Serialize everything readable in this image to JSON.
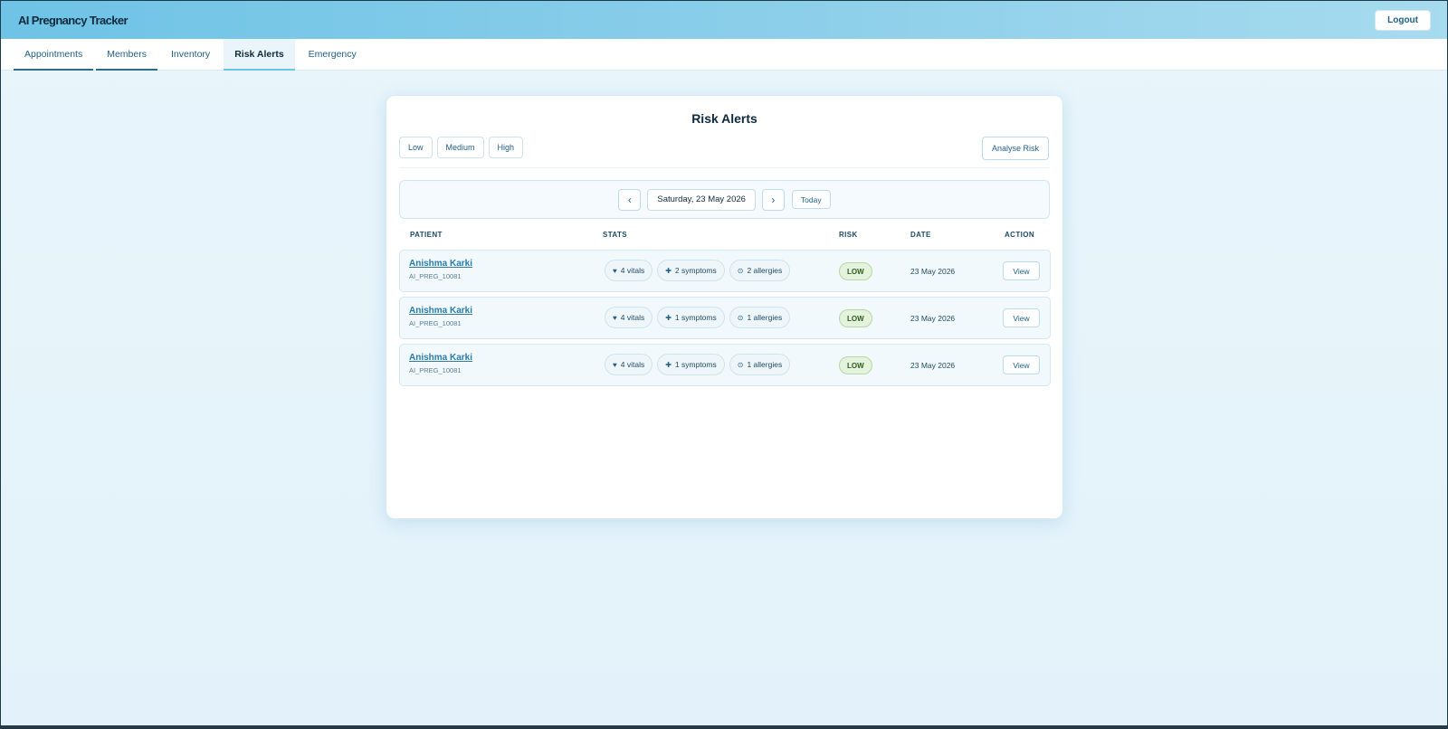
{
  "app": {
    "title": "AI Pregnancy Tracker",
    "logout_label": "Logout"
  },
  "tabs": [
    {
      "label": "Appointments"
    },
    {
      "label": "Members"
    },
    {
      "label": "Inventory"
    },
    {
      "label": "Risk Alerts"
    },
    {
      "label": "Emergency"
    }
  ],
  "page": {
    "title": "Risk Alerts",
    "filters": [
      "Low",
      "Medium",
      "High"
    ],
    "analyse_label": "Analyse Risk",
    "date_label": "Saturday, 23 May 2026",
    "prev_glyph": "‹",
    "next_glyph": "›",
    "today_label": "Today"
  },
  "table": {
    "headers": {
      "patient": "PATIENT",
      "stats": "STATS",
      "risk": "RISK",
      "date": "DATE",
      "action": "ACTION"
    },
    "rows": [
      {
        "name": "Anishma Karki",
        "id": "AI_PREG_10081",
        "vitals": "4 vitals",
        "symptoms": "2 symptoms",
        "allergies": "2 allergies",
        "risk": "LOW",
        "date": "23 May 2026",
        "action": "View"
      },
      {
        "name": "Anishma Karki",
        "id": "AI_PREG_10081",
        "vitals": "4 vitals",
        "symptoms": "1 symptoms",
        "allergies": "1 allergies",
        "risk": "LOW",
        "date": "23 May 2026",
        "action": "View"
      },
      {
        "name": "Anishma Karki",
        "id": "AI_PREG_10081",
        "vitals": "4 vitals",
        "symptoms": "1 symptoms",
        "allergies": "1 allergies",
        "risk": "LOW",
        "date": "23 May 2026",
        "action": "View"
      }
    ]
  },
  "icons": {
    "vitals": "heart-icon",
    "symptoms": "plus-icon",
    "allergies": "target-icon"
  }
}
